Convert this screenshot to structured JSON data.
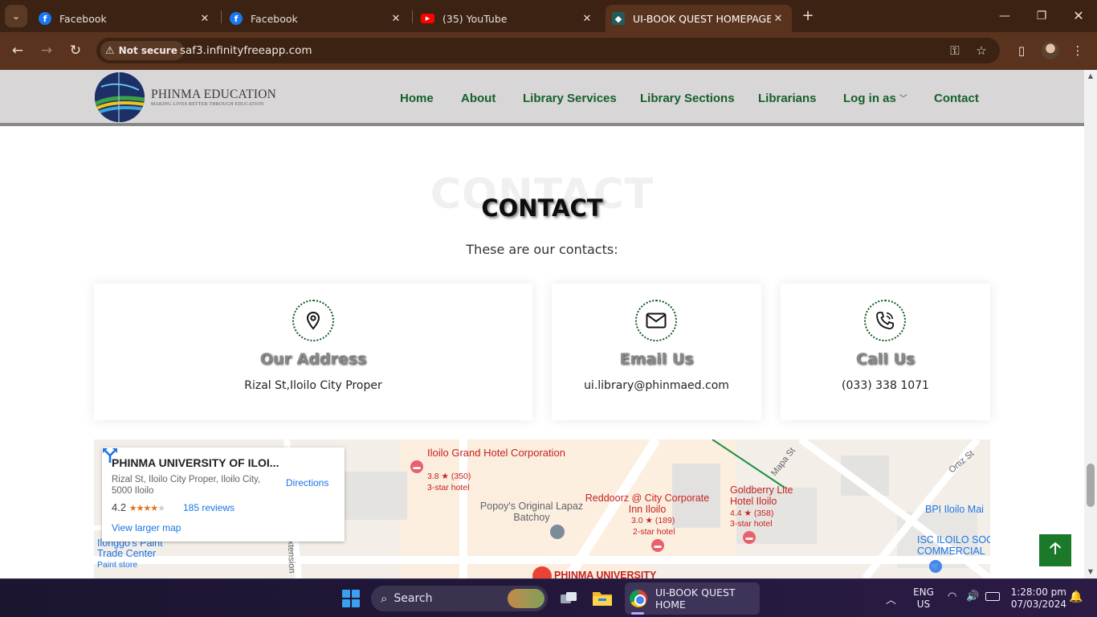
{
  "browser": {
    "tabs": [
      {
        "title": "Facebook",
        "favicon": "facebook-icon"
      },
      {
        "title": "Facebook",
        "favicon": "facebook-icon"
      },
      {
        "title": "(35) YouTube",
        "favicon": "youtube-icon"
      },
      {
        "title": "UI-BOOK QUEST HOMEPAGE",
        "favicon": "phinma-icon",
        "active": true
      }
    ],
    "security_label": "Not secure",
    "url": "saf3.infinityfreeapp.com"
  },
  "site": {
    "logo_text": "PHINMA EDUCATION",
    "logo_tagline": "MAKING LIVES BETTER THROUGH EDUCATION",
    "nav": [
      "Home",
      "About",
      "Library Services",
      "Library Sections",
      "Librarians",
      "Log in as",
      "Contact"
    ],
    "accent_color": "#15602b"
  },
  "contact": {
    "bg_title": "CONTACT",
    "title": "CONTACT",
    "subtitle": "These are our contacts:",
    "cards": [
      {
        "icon": "location-pin-icon",
        "title": "Our Address",
        "text": "Rizal St,Iloilo City Proper"
      },
      {
        "icon": "envelope-icon",
        "title": "Email Us",
        "text": "ui.library@phinmaed.com"
      },
      {
        "icon": "phone-icon",
        "title": "Call Us",
        "text": "(033) 338 1071"
      }
    ]
  },
  "map": {
    "place_name": "PHINMA UNIVERSITY OF ILOI...",
    "address": "Rizal St, Iloilo City Proper, Iloilo City, 5000 Iloilo",
    "rating": "4.2",
    "stars": 4.2,
    "reviews": "185 reviews",
    "directions_label": "Directions",
    "larger_map_label": "View larger map",
    "labels": {
      "grand_hotel_name": "Iloilo Grand Hotel Corporation",
      "grand_hotel_rating": "3.8 ★ (350)",
      "grand_hotel_class": "3-star hotel",
      "reddoorz_name": "Reddoorz @ City Corporate Inn Iloilo",
      "reddoorz_rating": "3.0 ★ (189)",
      "reddoorz_class": "2-star hotel",
      "goldberry_name": "Goldberry Lite Hotel Iloilo",
      "goldberry_rating": "4.4 ★ (358)",
      "goldberry_class": "3-star hotel",
      "popoys": "Popoy's Original Lapaz Batchoy",
      "paint_center": "Ilonggo's Paint Trade Center",
      "paint_store": "Paint store",
      "bpi": "BPI Iloilo Mai",
      "isc": "ISC ILOILO SOC COMMERCIAL",
      "phinma_pin": "PHINMA UNIVERSITY",
      "mapa_st": "Mapa St",
      "ortiz_st": "Ortiz St",
      "extension": "xtension"
    }
  },
  "taskbar": {
    "search_placeholder": "Search",
    "chrome_window": "UI-BOOK QUEST HOME",
    "lang_top": "ENG",
    "lang_bottom": "US",
    "time": "1:28:00 pm",
    "date": "07/03/2024"
  }
}
